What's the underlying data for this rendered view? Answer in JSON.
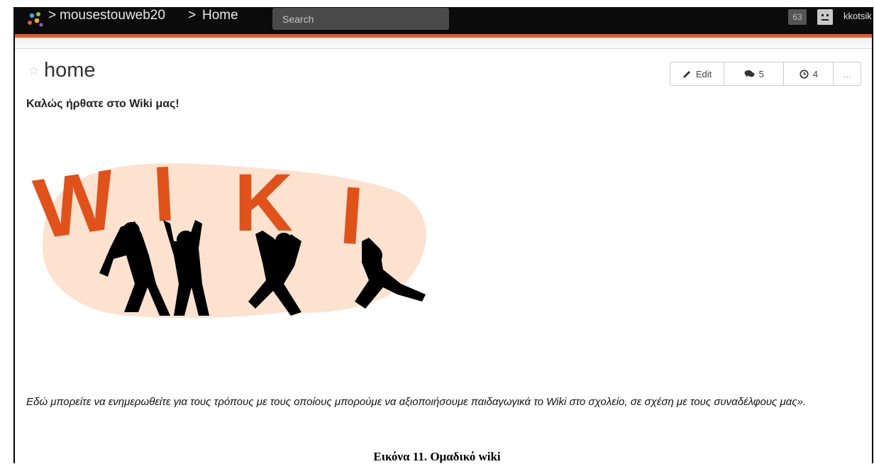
{
  "topbar": {
    "separator": ">",
    "site_name": "mousestouweb20",
    "page_crumb": "Home",
    "search_placeholder": "Search",
    "notification_count": "63",
    "username": "kkotsikou"
  },
  "page": {
    "title": "home",
    "actions": {
      "edit_label": "Edit",
      "comments_count": "5",
      "history_count": "4",
      "more_label": "..."
    },
    "welcome": "Καλώς ήρθατε στο Wiki μας!",
    "image_letters": [
      "W",
      "I",
      "K",
      "I"
    ],
    "description": "Εδώ μπορείτε να ενημερωθείτε για τους τρόπους με τους οποίους μπορούμε να αξιοποιήσουμε παιδαγωγικά το Wiki στο σχολείο, σε σχέση με τους συναδέλφους μας».",
    "caption": "Εικόνα 11. Ομαδικό wiki"
  },
  "colors": {
    "topbar_bg": "#0b0b0b",
    "accent": "#e35a26",
    "letter_color": "#e1521b",
    "blob_color": "#fde3cf"
  }
}
